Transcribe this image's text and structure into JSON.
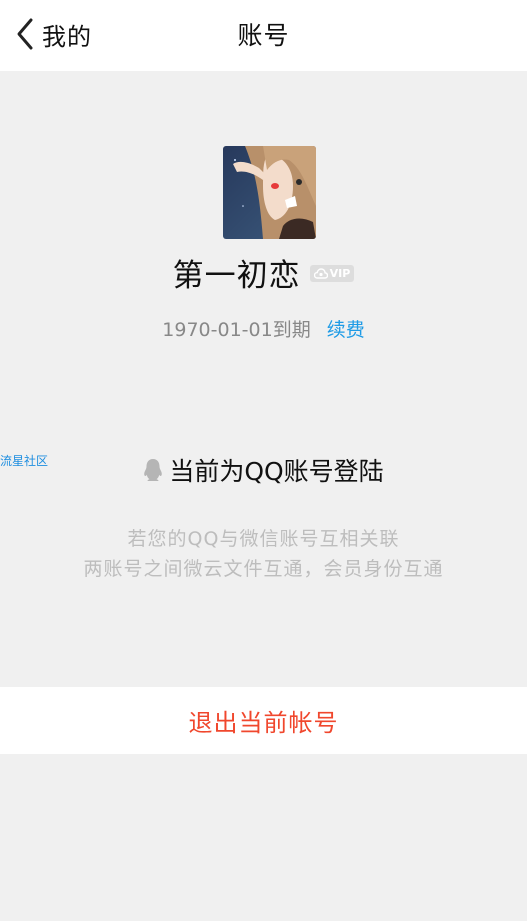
{
  "nav": {
    "back_label": "我的",
    "title": "账号"
  },
  "profile": {
    "username": "第一初恋",
    "vip_label": "VIP",
    "expire_text": "1970-01-01到期",
    "renew_label": "续费"
  },
  "watermark": "流星社区",
  "login": {
    "status_text": "当前为QQ账号登陆",
    "desc_line1": "若您的QQ与微信账号互相关联",
    "desc_line2": "两账号之间微云文件互通，会员身份互通"
  },
  "logout_label": "退出当前帐号",
  "colors": {
    "accent_blue": "#1e9be6",
    "logout_red": "#f0472d",
    "background": "#f0f0f0"
  },
  "icons": {
    "back": "chevron-left-icon",
    "vip_cloud": "cloud-icon",
    "qq": "qq-penguin-icon"
  }
}
